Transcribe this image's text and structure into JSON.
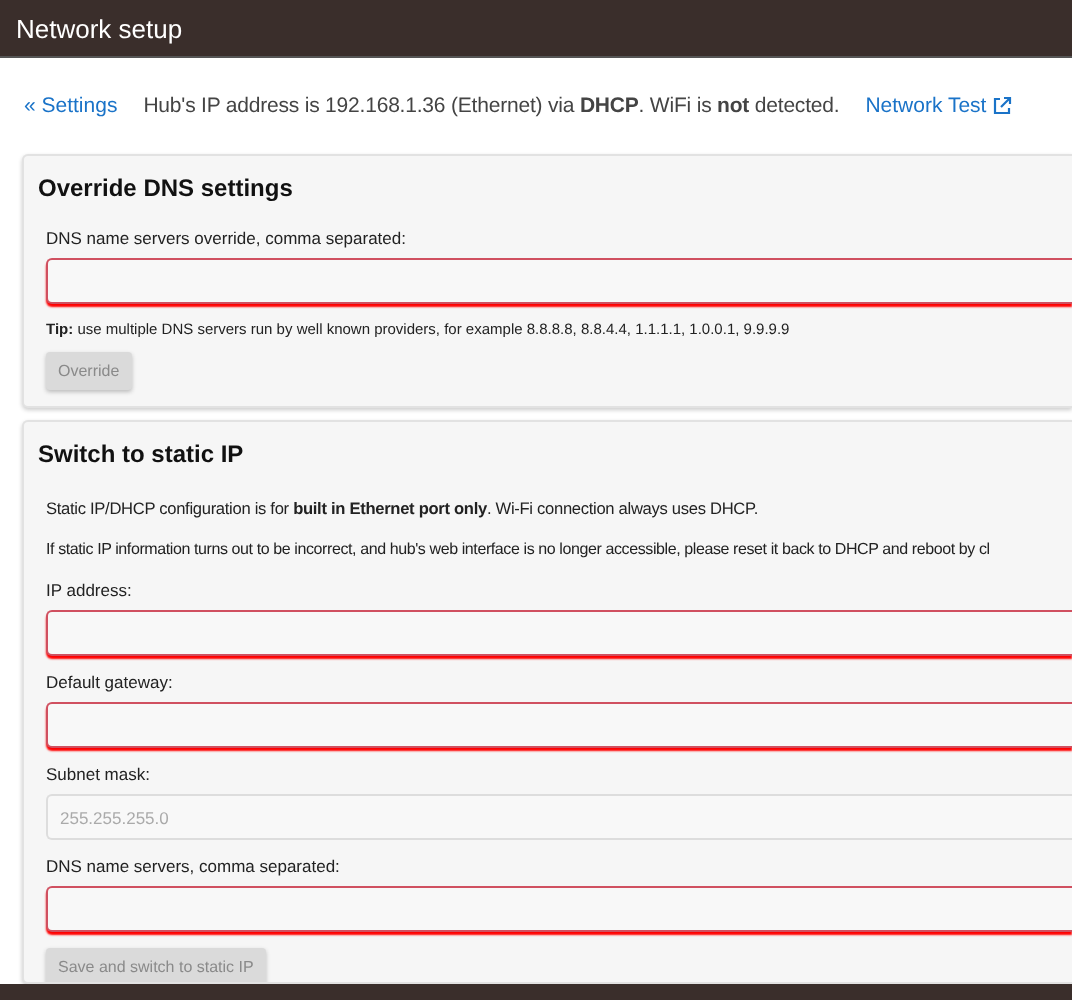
{
  "window": {
    "title": "Network setup"
  },
  "status_line": {
    "back_link": "« Settings",
    "message": "Hub's IP address is 192.168.1.36 (Ethernet) via **DHCP**.  WiFi is **not** detected.",
    "test_link": "Network Test"
  },
  "dns_override": {
    "title": "Override DNS settings",
    "field": {
      "label": "DNS name servers override, comma separated:",
      "invalid": true
    },
    "tip": "**Tip:** use multiple DNS servers run by well known providers, for example 8.8.8.8, 8.8.4.4, 1.1.1.1, 1.0.0.1, 9.9.9.9",
    "button": {
      "label": "Override",
      "disabled": true
    }
  },
  "static_ip": {
    "title": "Switch to static IP",
    "notes": [
      "Static IP/DHCP configuration is for **built in Ethernet port only**. Wi-Fi connection always uses DHCP.",
      "If static IP information turns out to be incorrect, and hub's web interface is no longer accessible, please reset it back to DHCP and reboot by cl"
    ],
    "fields": [
      {
        "label": "IP address:",
        "invalid": true
      },
      {
        "label": "Default gateway:",
        "invalid": true
      },
      {
        "label": "Subnet mask:",
        "placeholder": "255.255.255.0",
        "invalid": false
      },
      {
        "label": "DNS name servers, comma separated:",
        "invalid": true
      }
    ],
    "button": {
      "label": "Save and switch to static IP",
      "disabled": true
    }
  }
}
